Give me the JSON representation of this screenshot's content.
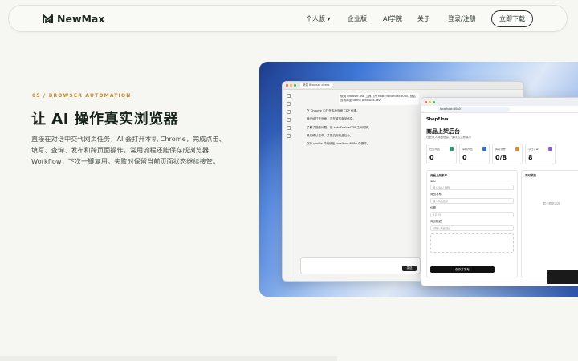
{
  "nav": {
    "brand": "NewMax",
    "links": [
      "个人版",
      "企业版",
      "AI学院",
      "关于",
      "登录/注册"
    ],
    "download": "立即下载"
  },
  "section": {
    "eyebrow": "05 / BROWSER AUTOMATION",
    "title": "让 AI 操作真实浏览器",
    "desc": "直接在对话中交代网页任务，AI 会打开本机 Chrome，完成点击、填写、查询、发布和跨页面操作。常用流程还能保存成浏览器 Workflow，下次一键复用，失败时保留当前页面状态继续接管。"
  },
  "mock": {
    "chat_tab": "新建 Browser demo",
    "chat_lines": [
      "使用 browser-use 工具打开 http://localhost:8080, 然后查找商品 demo products.csv。",
      "在 Chrome 中打开本地页面 CDP 代理。",
      "我已经打开页面，正在填写商品信息。",
      "了解了您的问题，在 autoEnableCDP 之间切换。",
      "最后确认表单，并提交到商品后台。",
      "保存 profile 并继续在 localhost:8080 中操作。"
    ],
    "send": "发送",
    "url": "localhost:8080",
    "app_brand": "ShopFlow",
    "page_title": "商品上架后台",
    "page_sub": "在此录入商品信息，保存后立即展示",
    "stats": [
      {
        "label": "在售商品",
        "value": "0",
        "color": "#22a06b"
      },
      {
        "label": "草稿商品",
        "value": "0",
        "color": "#2f6fe0"
      },
      {
        "label": "库存预警",
        "value": "0/8",
        "color": "#e08a2f"
      },
      {
        "label": "今日订单",
        "value": "8",
        "color": "#8a5ce0"
      }
    ],
    "form_title": "商品上架表单",
    "fields": [
      "SKU",
      "商品名称",
      "价格",
      "库存",
      "商品描述"
    ],
    "field_placeholders": [
      "输入 SKU 编码",
      "输入商品名称",
      "¥ 0.00",
      "数量",
      "请输入商品描述"
    ],
    "save": "保存并发布",
    "preview_title": "实时预览",
    "preview_empty": "暂无预览内容"
  }
}
